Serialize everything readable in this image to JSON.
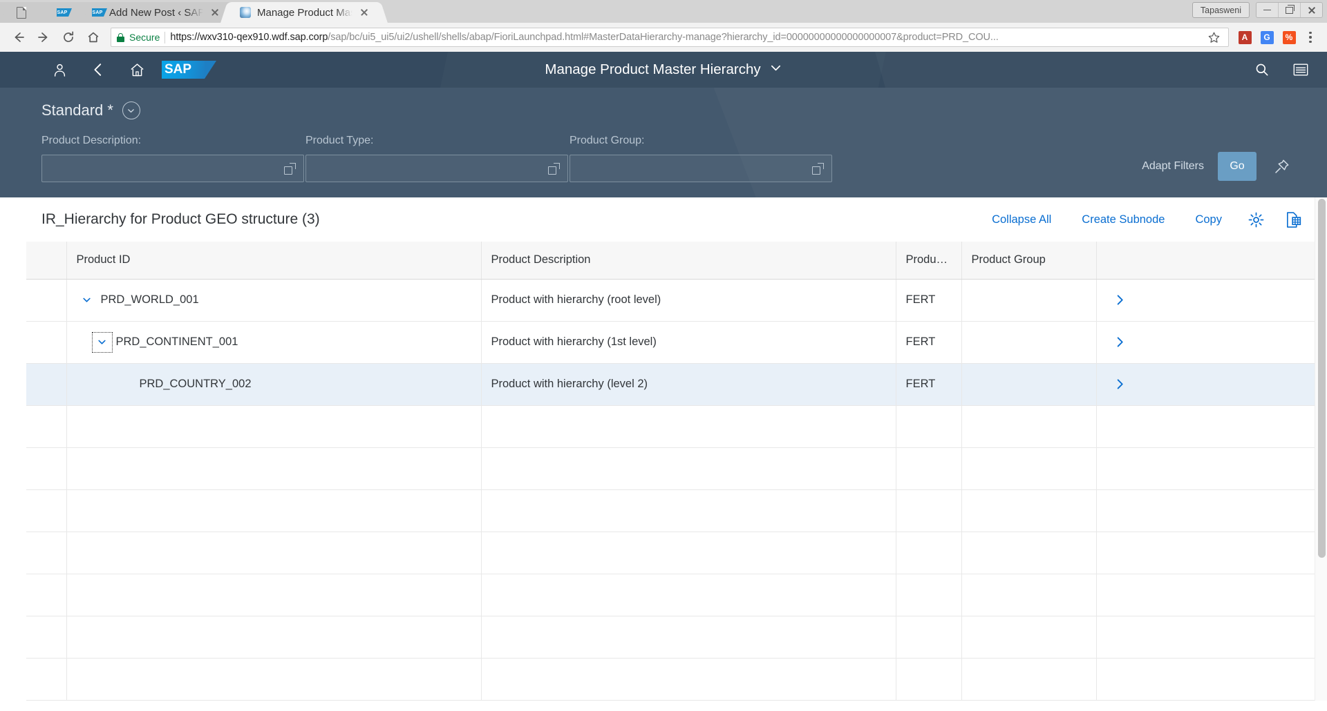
{
  "browser": {
    "tabs": [
      {
        "title": "",
        "favicon": "document-icon",
        "state": "inactive",
        "kind": "blank"
      },
      {
        "title": "",
        "favicon": "sap-icon",
        "state": "inactive",
        "kind": "mini"
      },
      {
        "title": "Add New Post ‹ SAP Blog",
        "favicon": "sap-icon",
        "state": "inactive",
        "kind": "normal"
      },
      {
        "title": "Manage Product Master",
        "favicon": "flower-icon",
        "state": "active",
        "kind": "normal"
      }
    ],
    "profile_label": "Tapasweni",
    "window_controls": {
      "minimize": "minimize-icon",
      "restore": "restore-icon",
      "close": "close-icon"
    },
    "nav": {
      "back": "back-arrow-icon",
      "forward": "forward-arrow-icon",
      "reload": "reload-icon",
      "home": "home-icon"
    },
    "omnibox": {
      "security_label": "Secure",
      "url_scheme_host": "https://wxv310-qex910.wdf.sap.corp",
      "url_path": "/sap/bc/ui5_ui5/ui2/ushell/shells/abap/",
      "url_page": "FioriLaunchpad.html#MasterDataHierarchy-manage?hierarchy_id=00000000000000000007&product=PRD_COU...",
      "bookmark": "star-icon"
    },
    "extensions": [
      {
        "name": "dictionary-extension",
        "glyph": "A",
        "color": "#c0392b"
      },
      {
        "name": "google-translate-extension",
        "glyph": "G",
        "color": "#4285f4"
      },
      {
        "name": "percent-extension",
        "glyph": "%",
        "color": "#f4511e"
      }
    ],
    "menu": "kebab-menu-icon"
  },
  "shell": {
    "user_icon": "user-icon",
    "back_icon": "back-icon",
    "home_icon": "home-icon",
    "logo_text": "SAP",
    "title": "Manage Product Master Hierarchy",
    "title_chevron": "chevron-down-icon",
    "search_icon": "search-icon",
    "menu_icon": "hamburger-menu-icon",
    "accent_color": "#354a5f"
  },
  "filter_bar": {
    "variant_label": "Standard *",
    "variant_chevron": "chevron-down-circle-icon",
    "fields": [
      {
        "label": "Product Description:",
        "value": "",
        "value_help": "value-help-icon"
      },
      {
        "label": "Product Type:",
        "value": "",
        "value_help": "value-help-icon"
      },
      {
        "label": "Product Group:",
        "value": "",
        "value_help": "value-help-icon"
      }
    ],
    "adapt_filters_label": "Adapt Filters",
    "go_label": "Go",
    "go_color": "#6a9ec4",
    "pin_icon": "pin-icon"
  },
  "table_toolbar": {
    "title": "IR_Hierarchy for Product GEO structure (3)",
    "actions": [
      {
        "label": "Collapse All",
        "name": "collapse-all-button"
      },
      {
        "label": "Create Subnode",
        "name": "create-subnode-button"
      },
      {
        "label": "Copy",
        "name": "copy-button"
      }
    ],
    "settings_icon": "gear-icon",
    "export_icon": "export-to-spreadsheet-icon",
    "link_color": "#0a6ed1"
  },
  "table": {
    "columns": [
      "",
      "Product ID",
      "Product Description",
      "Produ…",
      "Product Group",
      ""
    ],
    "rows": [
      {
        "product_id": "PRD_WORLD_001",
        "description": "Product with hierarchy (root level)",
        "product_type": "FERT",
        "product_group": "",
        "level": 0,
        "expanded": true,
        "selected": false,
        "focused": false,
        "nav": "navigation-chevron-icon"
      },
      {
        "product_id": "PRD_CONTINENT_001",
        "description": "Product with hierarchy (1st level)",
        "product_type": "FERT",
        "product_group": "",
        "level": 1,
        "expanded": true,
        "selected": false,
        "focused": true,
        "nav": "navigation-chevron-icon"
      },
      {
        "product_id": "PRD_COUNTRY_002",
        "description": "Product with hierarchy (level 2)",
        "product_type": "FERT",
        "product_group": "",
        "level": 2,
        "expanded": false,
        "selected": true,
        "focused": false,
        "nav": "navigation-chevron-icon"
      }
    ],
    "empty_row_count": 7,
    "selected_row_color": "#e8f0f8"
  }
}
